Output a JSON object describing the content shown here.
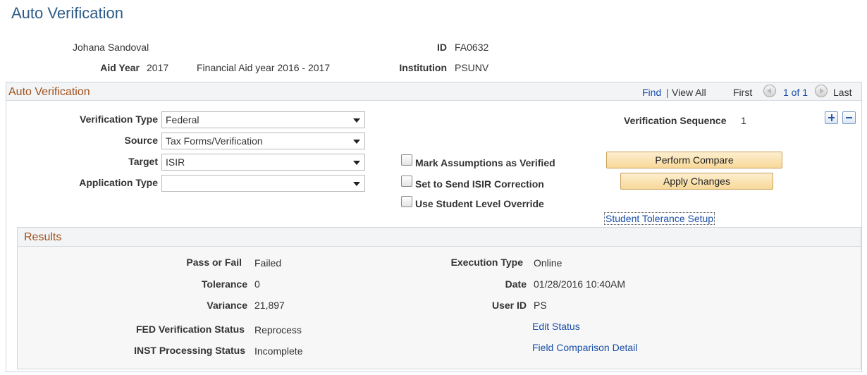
{
  "page": {
    "title": "Auto Verification"
  },
  "student": {
    "name": "Johana Sandoval",
    "id_label": "ID",
    "id_value": "FA0632",
    "aid_year_label": "Aid Year",
    "aid_year_value": "2017",
    "aid_year_desc": "Financial Aid year 2016 - 2017",
    "institution_label": "Institution",
    "institution_value": "PSUNV"
  },
  "section": {
    "title": "Auto Verification",
    "nav": {
      "find": "Find",
      "separator": "|",
      "view_all": "View All",
      "first": "First",
      "counter": "1 of 1",
      "last": "Last"
    }
  },
  "form": {
    "verification_type": {
      "label": "Verification Type",
      "value": "Federal"
    },
    "source": {
      "label": "Source",
      "value": "Tax Forms/Verification"
    },
    "target": {
      "label": "Target",
      "value": "ISIR"
    },
    "application_type": {
      "label": "Application Type",
      "value": ""
    },
    "verification_sequence": {
      "label": "Verification Sequence",
      "value": "1"
    },
    "checkboxes": {
      "mark_assumptions": "Mark Assumptions as Verified",
      "send_isir_correction": "Set to Send ISIR Correction",
      "student_level_override": "Use Student Level Override"
    },
    "buttons": {
      "perform_compare": "Perform Compare",
      "apply_changes": "Apply Changes"
    },
    "links": {
      "tolerance_setup": "Student Tolerance Setup"
    }
  },
  "results": {
    "title": "Results",
    "pass_fail": {
      "label": "Pass or Fail",
      "value": "Failed"
    },
    "tolerance": {
      "label": "Tolerance",
      "value": "0"
    },
    "variance": {
      "label": "Variance",
      "value": "21,897"
    },
    "fed_status": {
      "label": "FED Verification Status",
      "value": "Reprocess"
    },
    "inst_status": {
      "label": "INST Processing Status",
      "value": "Incomplete"
    },
    "execution_type": {
      "label": "Execution Type",
      "value": "Online"
    },
    "date": {
      "label": "Date",
      "value": "01/28/2016 10:40AM"
    },
    "user_id": {
      "label": "User ID",
      "value": "PS"
    },
    "links": {
      "edit_status": "Edit Status",
      "field_comparison": "Field Comparison Detail"
    }
  },
  "colors": {
    "title": "#2d5c88",
    "section_title": "#a0501c",
    "link": "#1a4ea8",
    "button": "#f8d999"
  },
  "icons": {
    "prev": "circle-left-arrow-icon",
    "next": "circle-right-arrow-icon",
    "add": "plus-icon",
    "remove": "minus-icon",
    "dropdown": "chevron-down-icon"
  }
}
